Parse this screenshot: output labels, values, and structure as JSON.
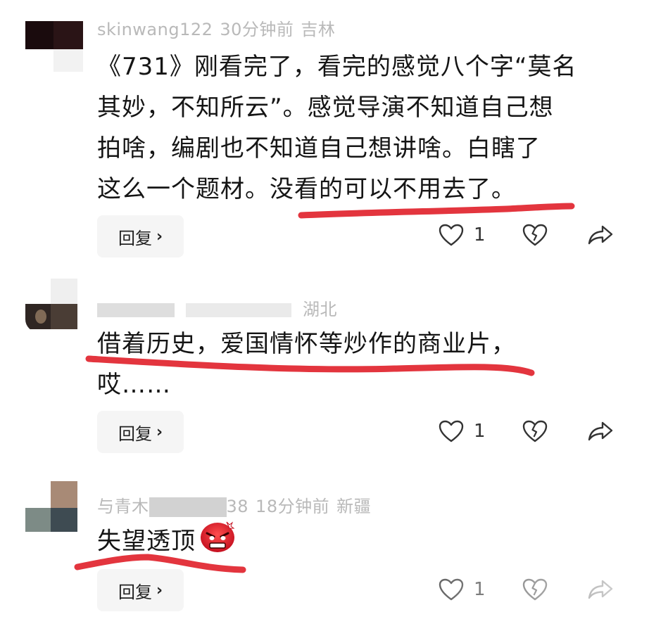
{
  "comments": [
    {
      "username": "skinwang122",
      "time": "30分钟前",
      "location": "吉林",
      "lines": [
        "《731》刚看完了，看完的感觉八个字“莫名",
        "其妙，不知所云”。感觉导演不知道自己想",
        "拍啥，编剧也不知道自己想讲啥。白瞎了",
        "这么一个题材。没看的可以不用去了。"
      ],
      "reply_label": "回复",
      "likes": "1"
    },
    {
      "username": "",
      "time": "",
      "location": "湖北",
      "lines": [
        "借着历史，爱国情怀等炒作的商业片，",
        "哎……"
      ],
      "reply_label": "回复",
      "likes": "1"
    },
    {
      "username": "与青木",
      "username_suffix": "38",
      "time": "18分钟前",
      "location": "新疆",
      "lines": [
        "失望透顶"
      ],
      "reply_label": "回复",
      "likes": "1"
    }
  ],
  "icons": [
    "heart-icon",
    "broken-heart-icon",
    "share-icon",
    "angry-face-emoji"
  ],
  "colors": {
    "underline": "#e3353e",
    "reply_bg": "#f5f5f5",
    "meta": "#b9b9b9"
  }
}
